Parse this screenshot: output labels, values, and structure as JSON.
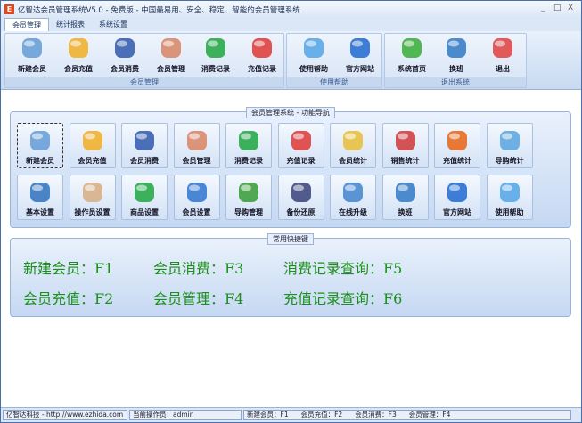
{
  "window": {
    "title": "亿智达会员管理系统V5.0 - 免费版 - 中国最易用、安全、稳定、智能的会员管理系统",
    "logo": "E",
    "minimize": "_",
    "maximize": "□",
    "close": "X"
  },
  "tabs": [
    {
      "label": "会员管理"
    },
    {
      "label": "统计报表"
    },
    {
      "label": "系统设置"
    }
  ],
  "ribbon": {
    "groups": [
      {
        "label": "会员管理"
      },
      {
        "label": "使用帮助"
      },
      {
        "label": "退出系统"
      }
    ],
    "buttons": [
      {
        "label": "新建会员",
        "icon": "penguin-icon",
        "color": "#6aa0d8"
      },
      {
        "label": "会员充值",
        "icon": "pencil-icon",
        "color": "#f0b030"
      },
      {
        "label": "会员消费",
        "icon": "finder-icon",
        "color": "#3a5fb0"
      },
      {
        "label": "会员管理",
        "icon": "user-icon",
        "color": "#d88a6a"
      },
      {
        "label": "消费记录",
        "icon": "cubes-doc-icon",
        "color": "#2aa84a"
      },
      {
        "label": "充值记录",
        "icon": "pie-doc-icon",
        "color": "#e04040"
      },
      {
        "label": "使用帮助",
        "icon": "help-bubble-icon",
        "color": "#5aa8e8"
      },
      {
        "label": "官方网站",
        "icon": "house-icon",
        "color": "#2a70d0"
      },
      {
        "label": "系统首页",
        "icon": "monitor-globe-icon",
        "color": "#40b040"
      },
      {
        "label": "换班",
        "icon": "refresh-globe-icon",
        "color": "#3a80c8"
      },
      {
        "label": "退出",
        "icon": "power-icon",
        "color": "#e04848"
      }
    ]
  },
  "nav": {
    "title": "会员管理系统 - 功能导航",
    "buttons": [
      {
        "label": "新建会员",
        "icon": "penguin-icon",
        "color": "#6aa0d8"
      },
      {
        "label": "会员充值",
        "icon": "pencil-icon",
        "color": "#f0b030"
      },
      {
        "label": "会员消费",
        "icon": "finder-icon",
        "color": "#3a5fb0"
      },
      {
        "label": "会员管理",
        "icon": "user-icon",
        "color": "#d88a6a"
      },
      {
        "label": "消费记录",
        "icon": "cubes-doc-icon",
        "color": "#2aa84a"
      },
      {
        "label": "充值记录",
        "icon": "pie-doc-icon",
        "color": "#e04040"
      },
      {
        "label": "会员统计",
        "icon": "pie-chart-icon",
        "color": "#e8c040"
      },
      {
        "label": "销售统计",
        "icon": "line-chart-icon",
        "color": "#d04040"
      },
      {
        "label": "充值统计",
        "icon": "pie-3d-icon",
        "color": "#e86a20"
      },
      {
        "label": "导购统计",
        "icon": "bar-chart-icon",
        "color": "#60a8e0"
      },
      {
        "label": "基本设置",
        "icon": "monitor-icon",
        "color": "#3a78c0"
      },
      {
        "label": "操作员设置",
        "icon": "operator-icon",
        "color": "#d8b088"
      },
      {
        "label": "商品设置",
        "icon": "cubes-icon",
        "color": "#2aa84a"
      },
      {
        "label": "会员设置",
        "icon": "pawn-icon",
        "color": "#3a7ad0"
      },
      {
        "label": "导购管理",
        "icon": "users-icon",
        "color": "#40a040"
      },
      {
        "label": "备份还原",
        "icon": "floppy-icon",
        "color": "#404a80"
      },
      {
        "label": "在线升级",
        "icon": "globe-icon",
        "color": "#4a8ad0"
      },
      {
        "label": "换班",
        "icon": "refresh-globe-icon",
        "color": "#3a80c8"
      },
      {
        "label": "官方网站",
        "icon": "house-icon",
        "color": "#2a70d0"
      },
      {
        "label": "使用帮助",
        "icon": "help-bubble-icon",
        "color": "#5aa8e8"
      }
    ]
  },
  "shortcuts": {
    "title": "常用快捷键",
    "items": [
      "新建会员：F1",
      "会员消费：F3",
      "消费记录查询：F5",
      "会员充值：F2",
      "会员管理：F4",
      "充值记录查询：F6"
    ]
  },
  "status": {
    "company": "亿智达科技 - http://www.ezhida.com",
    "operator": "当前操作员：admin",
    "keys": [
      "新建会员：F1",
      "会员充值：F2",
      "会员消费：F3",
      "会员管理：F4"
    ]
  }
}
